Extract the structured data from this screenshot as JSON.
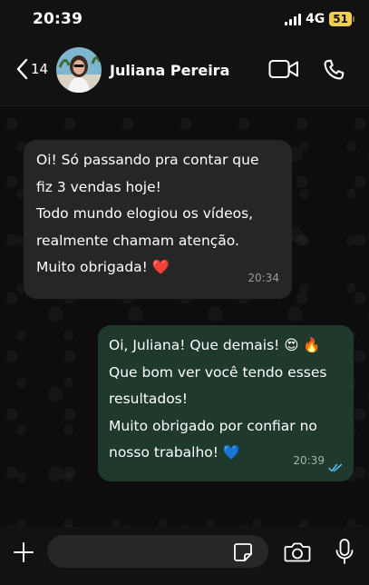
{
  "status_bar": {
    "time": "20:39",
    "network": "4G",
    "battery": "51"
  },
  "header": {
    "back_count": "14",
    "contact_name": "Juliana Pereira"
  },
  "messages": [
    {
      "direction": "incoming",
      "lines": [
        "Oi! Só passando pra contar que",
        "fiz 3 vendas hoje!",
        "Todo mundo elogiou os vídeos,",
        "realmente chamam atenção.",
        "Muito obrigada! ❤️"
      ],
      "time": "20:34"
    },
    {
      "direction": "outgoing",
      "lines": [
        "Oi, Juliana! Que demais! 😍 🔥",
        "Que bom ver você tendo esses",
        "resultados!",
        "Muito obrigado por confiar no",
        "nosso trabalho! 💙"
      ],
      "time": "20:39",
      "status": "read"
    }
  ],
  "colors": {
    "incoming_bubble": "#262626",
    "outgoing_bubble": "#1f3a2d",
    "read_ticks": "#53bdeb",
    "battery": "#f2cf4a"
  },
  "icons": [
    "back-chevron-icon",
    "video-call-icon",
    "phone-icon",
    "plus-icon",
    "sticker-icon",
    "camera-icon",
    "microphone-icon",
    "double-check-icon"
  ]
}
